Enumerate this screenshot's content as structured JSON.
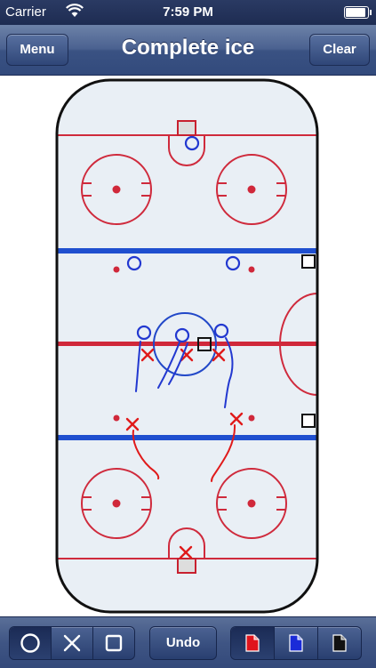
{
  "status": {
    "carrier": "Carrier",
    "time": "7:59 PM",
    "wifi_icon": "wifi-icon",
    "battery_icon": "battery-icon"
  },
  "nav": {
    "menu_label": "Menu",
    "title": "Complete ice",
    "clear_label": "Clear"
  },
  "toolbar": {
    "shapes": [
      {
        "name": "circle-tool",
        "icon": "circle-icon",
        "selected": true
      },
      {
        "name": "x-tool",
        "icon": "x-icon",
        "selected": false
      },
      {
        "name": "square-tool",
        "icon": "square-icon",
        "selected": false
      }
    ],
    "undo_label": "Undo",
    "colors": [
      {
        "name": "red-pen",
        "hex": "#e0141c",
        "selected": true
      },
      {
        "name": "blue-pen",
        "hex": "#1a2bd8",
        "selected": false
      },
      {
        "name": "black-pen",
        "hex": "#111111",
        "selected": false
      }
    ]
  },
  "rink": {
    "ice_color": "#eaf0f5",
    "red_line_color": "#d0283a",
    "blue_line_color": "#1f4fcf",
    "marker_blue": "#2238d0",
    "marker_red": "#e01a1a"
  }
}
